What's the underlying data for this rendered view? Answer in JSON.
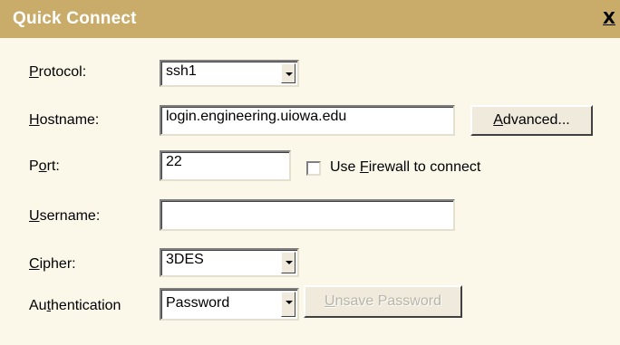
{
  "window": {
    "title": "Quick Connect",
    "close_glyph": "X"
  },
  "form": {
    "protocol": {
      "label": "Protocol:",
      "value": "ssh1"
    },
    "hostname": {
      "label": "Hostname:",
      "value": "login.engineering.uiowa.edu",
      "button": "Advanced..."
    },
    "port": {
      "label": "Port:",
      "value": "22",
      "checkbox_label": "Use Firewall to connect",
      "checked": false
    },
    "username": {
      "label": "Username:",
      "value": ""
    },
    "cipher": {
      "label": "Cipher:",
      "value": "3DES"
    },
    "authentication": {
      "label": "Authentication",
      "value": "Password",
      "button": "Unsave Password",
      "button_enabled": false
    }
  },
  "colors": {
    "titlebar": "#c9ac6a",
    "background": "#fbf8ea",
    "control_face": "#efeadc"
  }
}
